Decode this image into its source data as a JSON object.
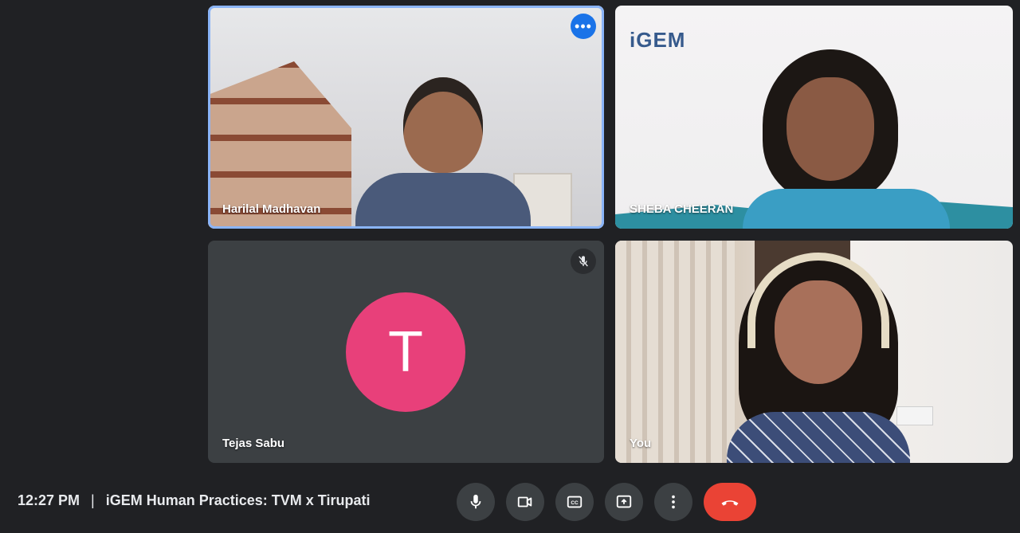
{
  "participants": [
    {
      "name": "Harilal Madhavan",
      "active_speaker": true
    },
    {
      "name": "SHEBA CHEERAN",
      "watermark": "iGEM"
    },
    {
      "name": "Tejas Sabu",
      "avatar_letter": "T",
      "avatar_color": "#e8407a",
      "muted": true
    },
    {
      "name": "You"
    }
  ],
  "bottom_bar": {
    "time": "12:27 PM",
    "separator": "|",
    "meeting_title": "iGEM Human Practices: TVM x Tirupati"
  },
  "controls": [
    {
      "icon": "microphone-icon"
    },
    {
      "icon": "camera-icon"
    },
    {
      "icon": "closed-captions-icon"
    },
    {
      "icon": "present-screen-icon"
    },
    {
      "icon": "more-options-icon"
    },
    {
      "icon": "end-call-icon"
    }
  ],
  "colors": {
    "background": "#202124",
    "accent": "#1a73e8",
    "end_call": "#ea4335"
  }
}
